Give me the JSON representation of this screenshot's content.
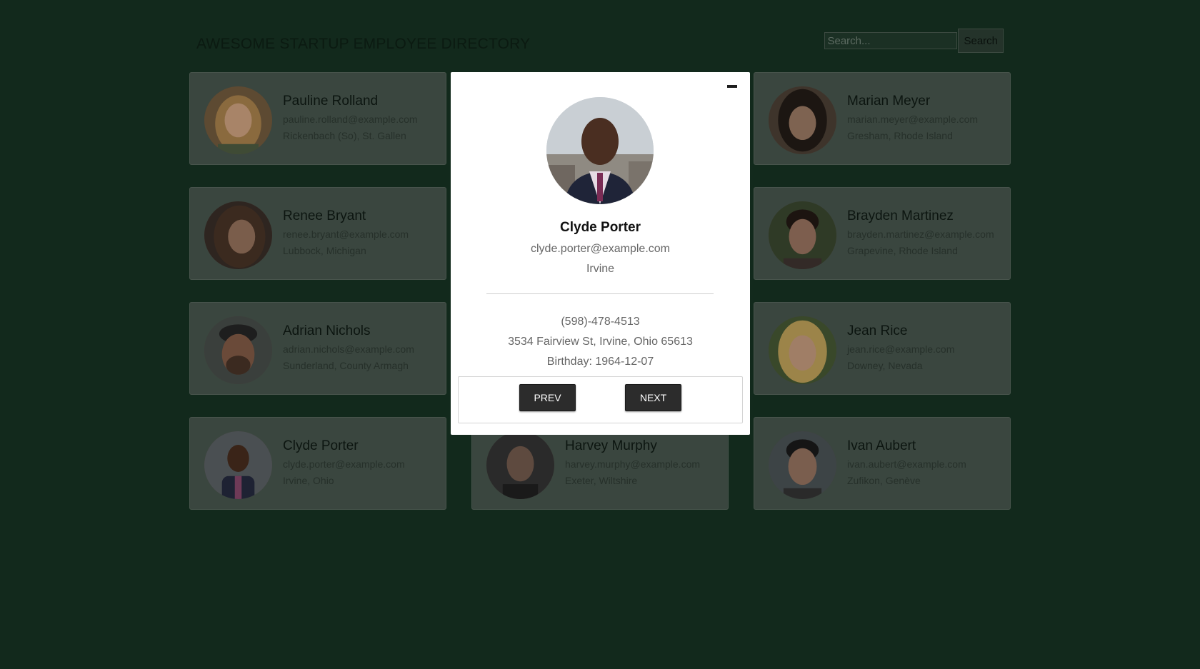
{
  "header": {
    "title": "AWESOME STARTUP EMPLOYEE DIRECTORY",
    "search_placeholder": "Search...",
    "search_label": "Search"
  },
  "employees": [
    {
      "name": "Pauline Rolland",
      "email": "pauline.rolland@example.com",
      "location": "Rickenbach (So), St. Gallen"
    },
    {
      "name": "Marian Meyer",
      "email": "marian.meyer@example.com",
      "location": "Gresham, Rhode Island"
    },
    {
      "name": "Renee Bryant",
      "email": "renee.bryant@example.com",
      "location": "Lubbock, Michigan"
    },
    {
      "name": "Brayden Martinez",
      "email": "brayden.martinez@example.com",
      "location": "Grapevine, Rhode Island"
    },
    {
      "name": "Adrian Nichols",
      "email": "adrian.nichols@example.com",
      "location": "Sunderland, County Armagh"
    },
    {
      "name": "Jean Rice",
      "email": "jean.rice@example.com",
      "location": "Downey, Nevada"
    },
    {
      "name": "Clyde Porter",
      "email": "clyde.porter@example.com",
      "location": "Irvine, Ohio"
    },
    {
      "name": "Harvey Murphy",
      "email": "harvey.murphy@example.com",
      "location": "Exeter, Wiltshire"
    },
    {
      "name": "Ivan Aubert",
      "email": "ivan.aubert@example.com",
      "location": "Zufikon, Genève"
    }
  ],
  "modal": {
    "name": "Clyde Porter",
    "email": "clyde.porter@example.com",
    "city": "Irvine",
    "phone": "(598)-478-4513",
    "address": "3534 Fairview St, Irvine, Ohio 65613",
    "birthday": "Birthday: 1964-12-07",
    "prev_label": "PREV",
    "next_label": "NEXT"
  },
  "colors": {
    "background": "#12291c",
    "card": "#3a463f",
    "modal": "#ffffff",
    "button": "#2c2c2c"
  },
  "icons": {
    "close": "minus-close-icon"
  }
}
